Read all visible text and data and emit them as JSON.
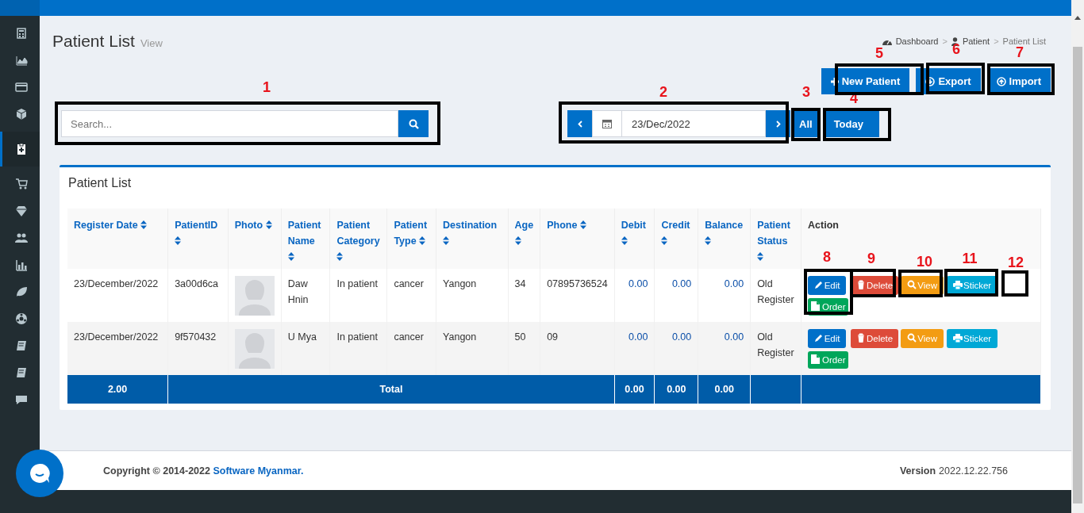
{
  "sidebar": {
    "items": [
      {
        "selected": false
      },
      {
        "selected": false
      },
      {
        "selected": false
      },
      {
        "selected": false
      },
      {
        "selected": true
      },
      {
        "selected": false
      },
      {
        "selected": false
      },
      {
        "selected": false
      },
      {
        "selected": false
      },
      {
        "selected": false
      },
      {
        "selected": false
      },
      {
        "selected": false
      },
      {
        "selected": false
      },
      {
        "selected": false
      }
    ]
  },
  "page": {
    "title": "Patient List",
    "subtitle": "View"
  },
  "breadcrumb": [
    "Dashboard",
    "Patient",
    "Patient List"
  ],
  "breadcrumb_separator": ">",
  "actions": [
    "New Patient",
    "Export",
    "Import"
  ],
  "search": {
    "placeholder": "Search..."
  },
  "date_filter": {
    "value": "23/Dec/2022",
    "buttons": [
      {
        "label": "All"
      },
      {
        "label": "Today"
      }
    ]
  },
  "card": {
    "title": "Patient List"
  },
  "table": {
    "columns": [
      "Register Date",
      "PatientID",
      "Photo",
      "Patient Name",
      "Patient Category",
      "Patient Type",
      "Destination",
      "Age",
      "Phone",
      "Debit",
      "Credit",
      "Balance",
      "Patient Status",
      "Action"
    ],
    "rows": [
      {
        "cells": [
          "23/December/2022",
          "3a00d6ca",
          "",
          "Daw Hnin",
          "In patient",
          "cancer",
          "Yangon",
          "34",
          "07895736524",
          "0.00",
          "0.00",
          "0.00",
          "Old Register"
        ],
        "actions": [
          {
            "kind": "edit",
            "label": "Edit"
          },
          {
            "kind": "delete",
            "label": "Delete"
          },
          {
            "kind": "view",
            "label": "View"
          },
          {
            "kind": "sticker",
            "label": "Sticker"
          },
          {
            "kind": "order",
            "label": "Order"
          }
        ]
      },
      {
        "cells": [
          "23/December/2022",
          "9f570432",
          "",
          "U Mya",
          "In patient",
          "cancer",
          "Yangon",
          "50",
          "09",
          "0.00",
          "0.00",
          "0.00",
          "Old Register"
        ],
        "actions": [
          {
            "kind": "edit",
            "label": "Edit"
          },
          {
            "kind": "delete",
            "label": "Delete"
          },
          {
            "kind": "view",
            "label": "View"
          },
          {
            "kind": "sticker",
            "label": "Sticker"
          },
          {
            "kind": "order",
            "label": "Order"
          }
        ]
      }
    ],
    "footer": [
      "2.00",
      "Total",
      "0.00",
      "0.00",
      "0.00"
    ]
  },
  "footer": {
    "copyright": "Copyright © 2014-2022",
    "company": "Software Myanmar.",
    "version_label": "Version",
    "version": "2022.12.22.756"
  },
  "annotations": [
    "1",
    "2",
    "3",
    "4",
    "5",
    "6",
    "7",
    "8",
    "9",
    "10",
    "11",
    "12"
  ]
}
